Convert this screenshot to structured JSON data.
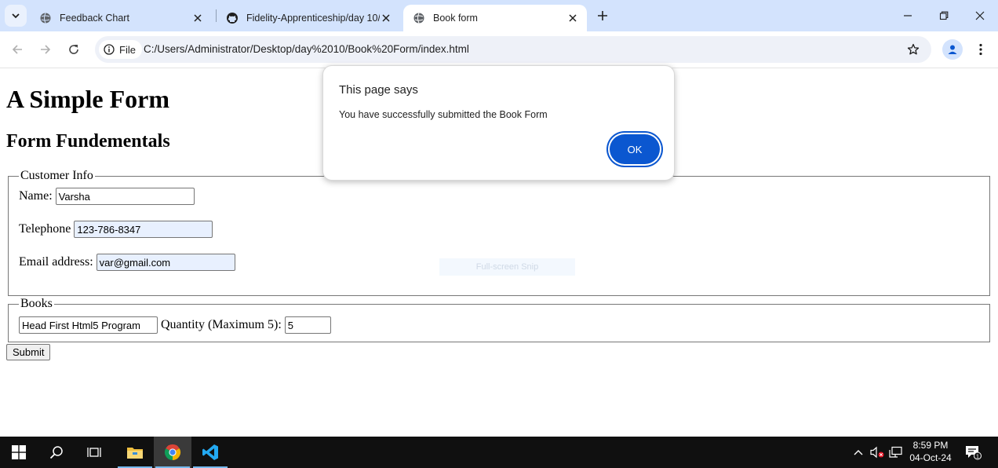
{
  "browser": {
    "tabs": [
      {
        "title": "Feedback Chart",
        "active": false
      },
      {
        "title": "Fidelity-Apprenticeship/day 10/",
        "active": false
      },
      {
        "title": "Book form",
        "active": true
      }
    ],
    "address": {
      "chip_label": "File",
      "url": "C:/Users/Administrator/Desktop/day%2010/Book%20Form/index.html"
    }
  },
  "page": {
    "heading1": "A Simple Form",
    "heading2": "Form Fundementals",
    "customer_info": {
      "legend": "Customer Info",
      "name_label": "Name:",
      "name_value": "Varsha",
      "telephone_label": "Telephone",
      "telephone_value": "123-786-8347",
      "email_label": "Email address:",
      "email_value": "var@gmail.com"
    },
    "books": {
      "legend": "Books",
      "book_value": "Head First Html5 Program",
      "quantity_label": "Quantity (Maximum 5):",
      "quantity_value": "5"
    },
    "submit_label": "Submit",
    "snip_overlay": "Full-screen Snip"
  },
  "dialog": {
    "title": "This page says",
    "message": "You have successfully submitted the Book Form",
    "ok_label": "OK"
  },
  "taskbar": {
    "time": "8:59 PM",
    "date": "04-Oct-24",
    "notification_count": "1"
  },
  "colors": {
    "tabstrip": "#d3e3fd",
    "accent": "#0b57d0",
    "taskbar": "#101010"
  }
}
